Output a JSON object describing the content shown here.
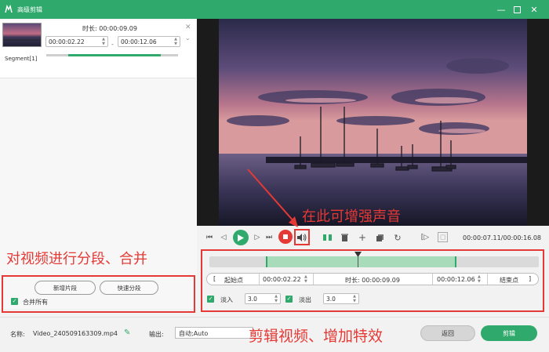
{
  "window": {
    "title": "高级剪辑"
  },
  "segment": {
    "label": "Segment[1]",
    "duration_label": "时长:",
    "duration_value": "00:00:09.09",
    "start_time": "00:00:02.22",
    "end_time": "00:00:12.06",
    "range_separator": "-"
  },
  "left_panel": {
    "new_segment_button": "新增片段",
    "quick_split_button": "快速分段",
    "merge_all_label": "合并所有",
    "merge_all_checked": true
  },
  "playback": {
    "time_readout": "00:00:07.11/00:00:16.08"
  },
  "trim": {
    "start_button": "起始点",
    "start_value": "00:00:02.22",
    "duration_label": "时长:",
    "duration_value": "00:00:09.09",
    "end_value": "00:00:12.06",
    "end_button": "结束点",
    "fade_in_label": "淡入",
    "fade_in_value": "3.0",
    "fade_out_label": "淡出",
    "fade_out_value": "3.0"
  },
  "bottom": {
    "name_label": "名称:",
    "file_name": "Video_240509163309.mp4",
    "output_label": "输出:",
    "output_value": "自动;Auto",
    "back_button": "返回",
    "edit_button": "剪辑"
  },
  "annotations": {
    "volume_note": "在此可增强声音",
    "split_merge_note": "对视频进行分段、合并",
    "edit_note": "剪辑视频、增加特效"
  },
  "colors": {
    "accent": "#2fa96c",
    "annotation": "#e53935",
    "stop_button": "#e53935"
  },
  "icons": [
    "logo-icon",
    "minimize-icon",
    "maximize-icon",
    "close-icon",
    "play-icon",
    "stop-icon",
    "volume-icon",
    "delete-icon",
    "add-icon",
    "copy-icon",
    "rotate-icon",
    "edit-icon"
  ]
}
